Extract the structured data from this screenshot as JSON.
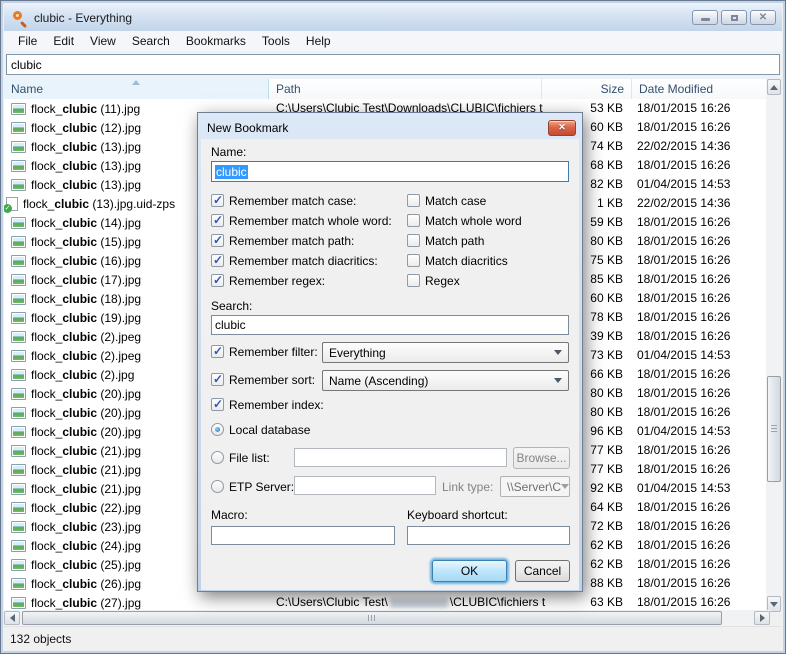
{
  "window": {
    "title": "clubic - Everything"
  },
  "menu": {
    "items": [
      "File",
      "Edit",
      "View",
      "Search",
      "Bookmarks",
      "Tools",
      "Help"
    ]
  },
  "search": {
    "value": "clubic"
  },
  "columns": [
    "Name",
    "Path",
    "Size",
    "Date Modified"
  ],
  "list": {
    "rows": [
      {
        "pre": "flock_",
        "match": "clubic",
        "suf": " (11).jpg",
        "icon": "image",
        "size": "53 KB",
        "date": "18/01/2015 16:26",
        "path": "C:\\Users\\Clubic Test\\Downloads\\CLUBIC\\fichiers t"
      },
      {
        "pre": "flock_",
        "match": "clubic",
        "suf": " (12).jpg",
        "icon": "image",
        "size": "60 KB",
        "date": "18/01/2015 16:26"
      },
      {
        "pre": "flock_",
        "match": "clubic",
        "suf": " (13).jpg",
        "icon": "image",
        "size": "74 KB",
        "date": "22/02/2015 14:36"
      },
      {
        "pre": "flock_",
        "match": "clubic",
        "suf": " (13).jpg",
        "icon": "image",
        "size": "68 KB",
        "date": "18/01/2015 16:26"
      },
      {
        "pre": "flock_",
        "match": "clubic",
        "suf": " (13).jpg",
        "icon": "image",
        "size": "82 KB",
        "date": "01/04/2015 14:53"
      },
      {
        "pre": "flock_",
        "match": "clubic",
        "suf": " (13).jpg.uid-zps",
        "icon": "doc",
        "size": "1 KB",
        "date": "22/02/2015 14:36"
      },
      {
        "pre": "flock_",
        "match": "clubic",
        "suf": " (14).jpg",
        "icon": "image",
        "size": "59 KB",
        "date": "18/01/2015 16:26"
      },
      {
        "pre": "flock_",
        "match": "clubic",
        "suf": " (15).jpg",
        "icon": "image",
        "size": "80 KB",
        "date": "18/01/2015 16:26"
      },
      {
        "pre": "flock_",
        "match": "clubic",
        "suf": " (16).jpg",
        "icon": "image",
        "size": "75 KB",
        "date": "18/01/2015 16:26"
      },
      {
        "pre": "flock_",
        "match": "clubic",
        "suf": " (17).jpg",
        "icon": "image",
        "size": "85 KB",
        "date": "18/01/2015 16:26"
      },
      {
        "pre": "flock_",
        "match": "clubic",
        "suf": " (18).jpg",
        "icon": "image",
        "size": "60 KB",
        "date": "18/01/2015 16:26"
      },
      {
        "pre": "flock_",
        "match": "clubic",
        "suf": " (19).jpg",
        "icon": "image",
        "size": "78 KB",
        "date": "18/01/2015 16:26"
      },
      {
        "pre": "flock_",
        "match": "clubic",
        "suf": " (2).jpeg",
        "icon": "image",
        "size": "39 KB",
        "date": "18/01/2015 16:26"
      },
      {
        "pre": "flock_",
        "match": "clubic",
        "suf": " (2).jpeg",
        "icon": "image",
        "size": "73 KB",
        "date": "01/04/2015 14:53"
      },
      {
        "pre": "flock_",
        "match": "clubic",
        "suf": " (2).jpg",
        "icon": "image",
        "size": "66 KB",
        "date": "18/01/2015 16:26"
      },
      {
        "pre": "flock_",
        "match": "clubic",
        "suf": " (20).jpg",
        "icon": "image",
        "size": "80 KB",
        "date": "18/01/2015 16:26"
      },
      {
        "pre": "flock_",
        "match": "clubic",
        "suf": " (20).jpg",
        "icon": "image",
        "size": "80 KB",
        "date": "18/01/2015 16:26"
      },
      {
        "pre": "flock_",
        "match": "clubic",
        "suf": " (20).jpg",
        "icon": "image",
        "size": "96 KB",
        "date": "01/04/2015 14:53"
      },
      {
        "pre": "flock_",
        "match": "clubic",
        "suf": " (21).jpg",
        "icon": "image",
        "size": "77 KB",
        "date": "18/01/2015 16:26"
      },
      {
        "pre": "flock_",
        "match": "clubic",
        "suf": " (21).jpg",
        "icon": "image",
        "size": "77 KB",
        "date": "18/01/2015 16:26"
      },
      {
        "pre": "flock_",
        "match": "clubic",
        "suf": " (21).jpg",
        "icon": "image",
        "size": "92 KB",
        "date": "01/04/2015 14:53"
      },
      {
        "pre": "flock_",
        "match": "clubic",
        "suf": " (22).jpg",
        "icon": "image",
        "size": "64 KB",
        "date": "18/01/2015 16:26"
      },
      {
        "pre": "flock_",
        "match": "clubic",
        "suf": " (23).jpg",
        "icon": "image",
        "size": "72 KB",
        "date": "18/01/2015 16:26"
      },
      {
        "pre": "flock_",
        "match": "clubic",
        "suf": " (24).jpg",
        "icon": "image",
        "size": "62 KB",
        "date": "18/01/2015 16:26"
      },
      {
        "pre": "flock_",
        "match": "clubic",
        "suf": " (25).jpg",
        "icon": "image",
        "size": "62 KB",
        "date": "18/01/2015 16:26"
      },
      {
        "pre": "flock_",
        "match": "clubic",
        "suf": " (26).jpg",
        "icon": "image",
        "size": "88 KB",
        "date": "18/01/2015 16:26"
      },
      {
        "pre": "flock_",
        "match": "clubic",
        "suf": " (27).jpg",
        "icon": "image",
        "size": "63 KB",
        "date": "18/01/2015 16:26",
        "path_parts": {
          "before": "C:\\Users\\Clubic Test\\",
          "blurred": true,
          "after": "\\CLUBIC\\fichiers t"
        }
      }
    ]
  },
  "statusbar": {
    "text": "132 objects"
  },
  "dialog": {
    "title": "New Bookmark",
    "name_label": "Name:",
    "name_value": "clubic",
    "remember_checks": [
      "Remember match case:",
      "Remember match whole word:",
      "Remember match path:",
      "Remember match diacritics:",
      "Remember regex:"
    ],
    "match_checks": [
      "Match case",
      "Match whole word",
      "Match path",
      "Match diacritics",
      "Regex"
    ],
    "search_label": "Search:",
    "search_value": "clubic",
    "filter_label": "Remember filter:",
    "filter_value": "Everything",
    "sort_label": "Remember sort:",
    "sort_value": "Name (Ascending)",
    "index_label": "Remember index:",
    "local_db_label": "Local database",
    "file_list_label": "File list:",
    "browse_label": "Browse...",
    "etp_label": "ETP Server:",
    "link_type_label": "Link type:",
    "link_type_value": "\\\\Server\\C",
    "macro_label": "Macro:",
    "shortcut_label": "Keyboard shortcut:",
    "ok_label": "OK",
    "cancel_label": "Cancel"
  },
  "colors": {
    "selection_blue": "#3399ff",
    "dialog_close_red": "#c24a2e",
    "titlebar_blue": "#c3d5ea",
    "default_button_ring": "#6db3e0"
  }
}
